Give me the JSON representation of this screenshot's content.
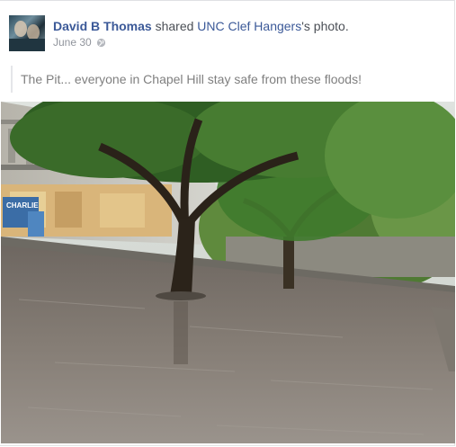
{
  "post": {
    "author": "David B Thomas",
    "verb": " shared ",
    "target": "UNC Clef Hangers",
    "target_suffix": "'s photo.",
    "date": "June 30",
    "privacy_icon": "globe-icon",
    "message": "The Pit... everyone in Chapel Hill stay safe from these floods!"
  },
  "photo": {
    "sign_text": "CHARLIE"
  },
  "colors": {
    "link": "#3b5998",
    "meta": "#90949c",
    "quote_text": "#7f7f7f"
  }
}
